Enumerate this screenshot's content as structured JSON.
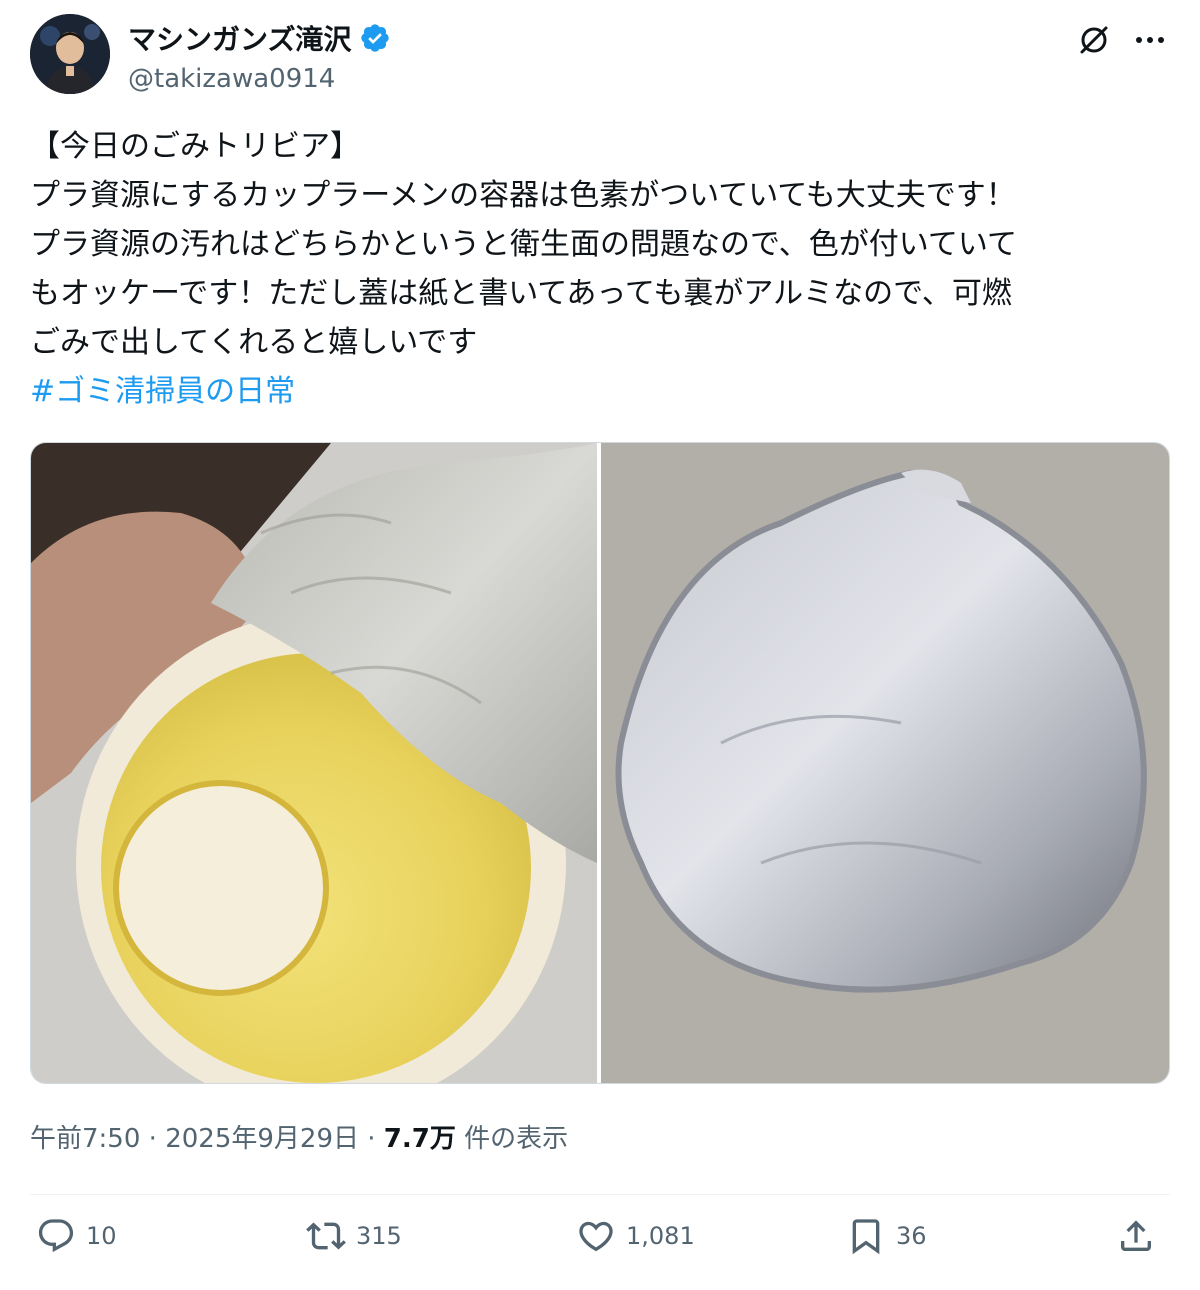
{
  "user": {
    "display_name": "マシンガンズ滝沢",
    "handle": "@takizawa0914",
    "verified": true
  },
  "tweet": {
    "lines": [
      "【今日のごみトリビア】",
      "プラ資源にするカップラーメンの容器は色素がついていても大丈夫です！",
      "プラ資源の汚れはどちらかというと衛生面の問題なので、色が付いていて",
      "もオッケーです！ただし蓋は紙と書いてあっても裏がアルミなので、可燃",
      "ごみで出してくれると嬉しいです"
    ],
    "hashtag": "#ゴミ清掃員の日常"
  },
  "media": [
    {
      "description_icon": "photo-cup-interior"
    },
    {
      "description_icon": "photo-aluminum-lid"
    }
  ],
  "meta": {
    "time": "午前7:50",
    "separator": "·",
    "date": "2025年9月29日",
    "views_count": "7.7万",
    "views_label": "件の表示"
  },
  "actions": {
    "replies": "10",
    "reposts": "315",
    "likes": "1,081",
    "bookmarks": "36"
  },
  "colors": {
    "accent": "#1d9bf0",
    "text": "#0f1419",
    "secondary": "#536471"
  }
}
